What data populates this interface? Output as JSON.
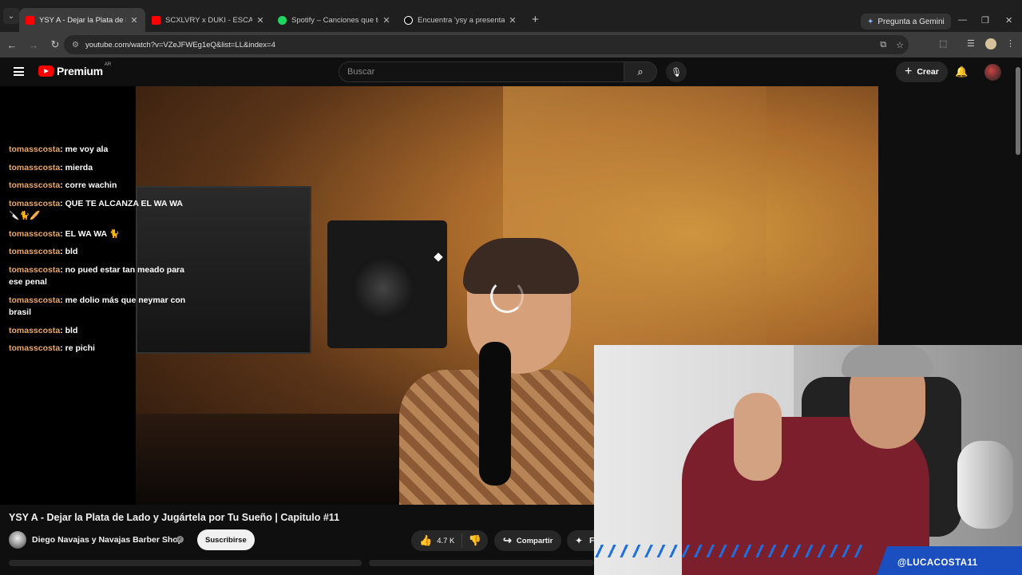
{
  "browser": {
    "tabs": [
      {
        "title": "YSY A - Dejar la Plata de Lado y",
        "favicon": "youtube-icon",
        "color": "#ff0000",
        "active": true
      },
      {
        "title": "SCXLVRY x DUKI - ESCALERA PE",
        "favicon": "youtube-icon",
        "color": "#ff0000",
        "active": false
      },
      {
        "title": "Spotify – Canciones que te gus",
        "favicon": "spotify-icon",
        "color": "#1ed760",
        "active": false
      },
      {
        "title": "Encuentra 'ysy a presentando a",
        "favicon": "tiktok-icon",
        "color": "#ffffff",
        "active": false
      }
    ],
    "gemini_label": "Pregunta a Gemini",
    "url": "youtube.com/watch?v=VZeJFWEg1eQ&list=LL&index=4"
  },
  "youtube": {
    "logo_text": "Premium",
    "country_code": "AR",
    "search_placeholder": "Buscar",
    "create_label": "Crear"
  },
  "chat": [
    {
      "user": "tomasscosta",
      "text": ": me voy ala"
    },
    {
      "user": "tomasscosta",
      "text": ": mierda"
    },
    {
      "user": "tomasscosta",
      "text": ": corre wachin"
    },
    {
      "user": "tomasscosta",
      "text": ": QUE TE ALCANZA EL WA WA 🔪🐈🥖"
    },
    {
      "user": "tomasscosta",
      "text": ": EL WA WA 🐈"
    },
    {
      "user": "tomasscosta",
      "text": ": bld"
    },
    {
      "user": "tomasscosta",
      "text": ": no pued estar tan meado para ese penal"
    },
    {
      "user": "tomasscosta",
      "text": ": me dolio más que neymar con brasil"
    },
    {
      "user": "tomasscosta",
      "text": ": bld"
    },
    {
      "user": "tomasscosta",
      "text": ": re pichi"
    }
  ],
  "overlay": {
    "handle": "@LUCACOSTA11"
  },
  "video": {
    "title": "YSY A - Dejar la Plata de Lado y Jugártela por Tu Sueño | Capitulo #11",
    "channel": "Diego Navajas y Navajas Barber Shop",
    "subscribe_label": "Suscribirse",
    "likes": "4.7 K",
    "share_label": "Compartir",
    "more_label": "F"
  },
  "colors": {
    "accent": "#ff0000",
    "chat_user": "#e8a86b",
    "overlay_blue": "#1b4fbf"
  }
}
